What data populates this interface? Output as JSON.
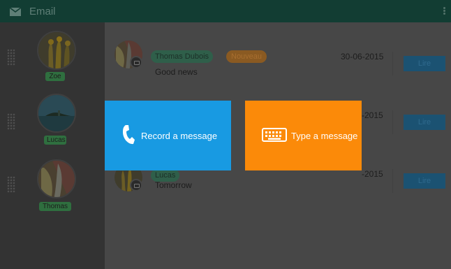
{
  "header": {
    "title": "Email"
  },
  "contacts": [
    {
      "name": "Zoe"
    },
    {
      "name": "Lucas"
    },
    {
      "name": "Thomas"
    }
  ],
  "messages": [
    {
      "sender": "Thomas Dubois",
      "badge": "Nouveau",
      "subject": "Good news",
      "date": "30-06-2015",
      "action": "Lire"
    },
    {
      "sender": "",
      "badge": "",
      "subject": "",
      "date": "-2015",
      "action": "Lire"
    },
    {
      "sender": "Lucas",
      "badge": "",
      "subject": "Tomorrow",
      "date": "-2015",
      "action": "Lire"
    }
  ],
  "dialog": {
    "record_label": "Record a message",
    "type_label": "Type a message"
  },
  "colors": {
    "header_bg": "#123d33",
    "record_tile": "#189ae2",
    "type_tile": "#fb8a09"
  }
}
